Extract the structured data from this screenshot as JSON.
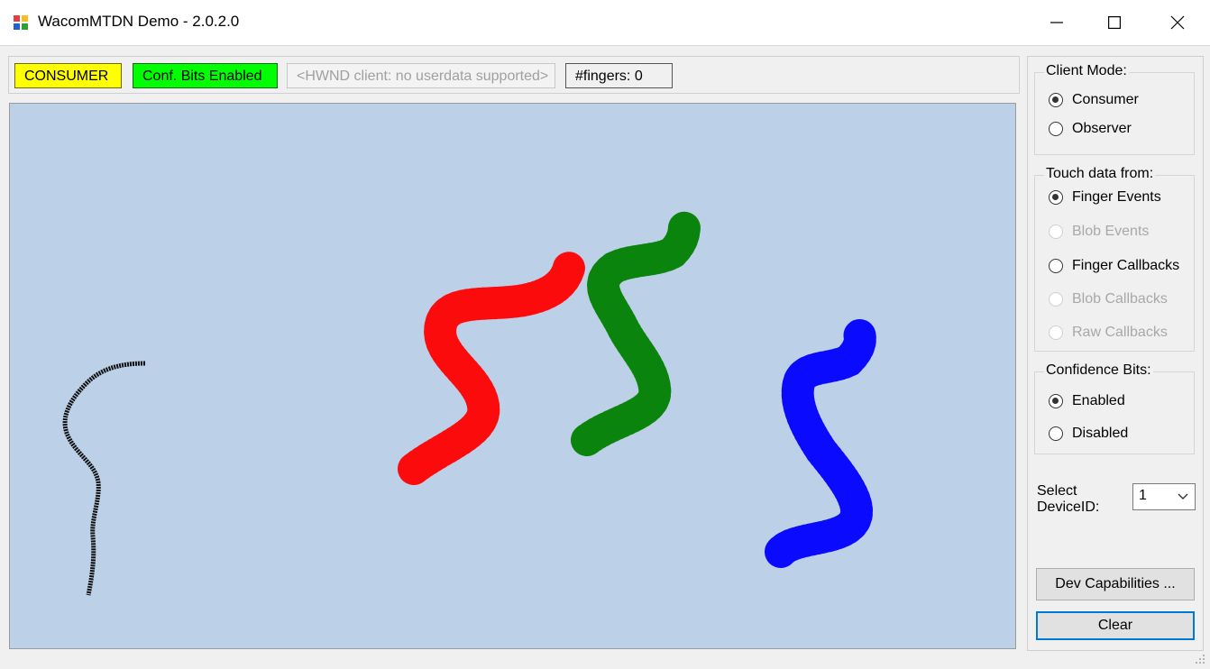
{
  "window": {
    "title": "WacomMTDN Demo - 2.0.2.0"
  },
  "status": {
    "mode": "CONSUMER",
    "conf_bits": "Conf. Bits Enabled",
    "hwnd": "<HWND client: no userdata supported>",
    "fingers": "#fingers: 0"
  },
  "colors": {
    "canvas_bg": "#bcd1e8",
    "stroke_black": "#111111",
    "stroke_red": "#ff0000",
    "stroke_green": "#008000",
    "stroke_blue": "#0000ff",
    "mode_badge": "#ffff00",
    "conf_badge": "#00ff00"
  },
  "client_mode": {
    "label": "Client Mode:",
    "options": [
      {
        "label": "Consumer",
        "checked": true
      },
      {
        "label": "Observer",
        "checked": false
      }
    ]
  },
  "touch_data": {
    "label": "Touch data from:",
    "options": [
      {
        "label": "Finger Events",
        "checked": true,
        "enabled": true
      },
      {
        "label": "Blob Events",
        "checked": false,
        "enabled": false
      },
      {
        "label": "Finger Callbacks",
        "checked": false,
        "enabled": true
      },
      {
        "label": "Blob Callbacks",
        "checked": false,
        "enabled": false
      },
      {
        "label": "Raw Callbacks",
        "checked": false,
        "enabled": false
      }
    ]
  },
  "confidence_bits": {
    "label": "Confidence Bits:",
    "options": [
      {
        "label": "Enabled",
        "checked": true
      },
      {
        "label": "Disabled",
        "checked": false
      }
    ]
  },
  "device": {
    "label": "Select DeviceID:",
    "value": "1"
  },
  "buttons": {
    "dev_caps": "Dev Capabilities ...",
    "clear": "Clear"
  }
}
